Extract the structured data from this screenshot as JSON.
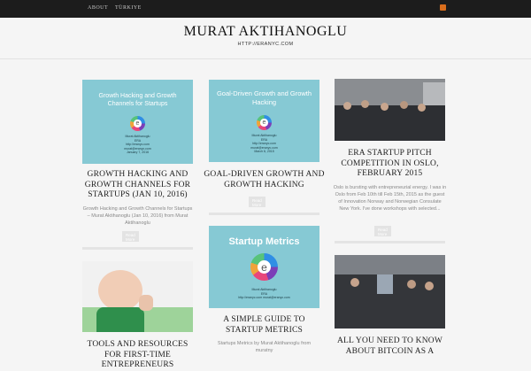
{
  "nav": {
    "about": "ABOUT",
    "turkiye": "TÜRKIYE"
  },
  "site": {
    "title": "MURAT AKTIHANOGLU",
    "url": "HTTP://ERANYC.COM"
  },
  "colors": {
    "topbar": "#1c1c1c",
    "slide": "#86c9d4",
    "rss": "#d86d1c"
  },
  "posts": [
    {
      "title": "GROWTH HACKING AND GROWTH CHANNELS FOR STARTUPS (JAN 10, 2016)",
      "slide_title": "Growth Hacking and Growth Channels for Startups",
      "slide_meta": "Murat Aktihanoglu\nERA\nhttp://eranyc.com\nmurat@eranyc.com\nJanuary 7, 2016",
      "excerpt": "Growth Hacking and Growth Channels for Startups – Murat Aktihanoglu (Jan 10, 2016) from Murat Aktihanoglu",
      "readmore": "Read More"
    },
    {
      "title": "GOAL-DRIVEN GROWTH AND GROWTH HACKING",
      "slide_title": "Goal-Driven Growth and Growth Hacking",
      "slide_meta": "Murat Aktihanoglu\nERA\nhttp://eranyc.com\nmurat@eranyc.com\nMarch 6, 2015",
      "readmore": "Read More"
    },
    {
      "title": "ERA STARTUP PITCH COMPETITION IN OSLO, FEBRUARY 2015",
      "excerpt": "Oslo is bursting with entrepreneurial energy. I was in Oslo from Feb 10th till Feb 15th, 2015 as the guest of Innovation Norway and Norwegian Consulate New York. I've done workshops with selected...",
      "readmore": "Read More"
    },
    {
      "title": "TOOLS AND RESOURCES FOR FIRST-TIME ENTREPRENEURS"
    },
    {
      "title": "A SIMPLE GUIDE TO STARTUP METRICS",
      "slide_title": "Startup Metrics",
      "slide_meta": "Murat Aktihanoglu\nERA\nhttp://eranyc.com murat@eranyc.com",
      "excerpt": "Startups Metrics by Murat Aktihanoglu from muratny"
    },
    {
      "title": "ALL YOU NEED TO KNOW ABOUT BITCOIN AS A"
    }
  ]
}
